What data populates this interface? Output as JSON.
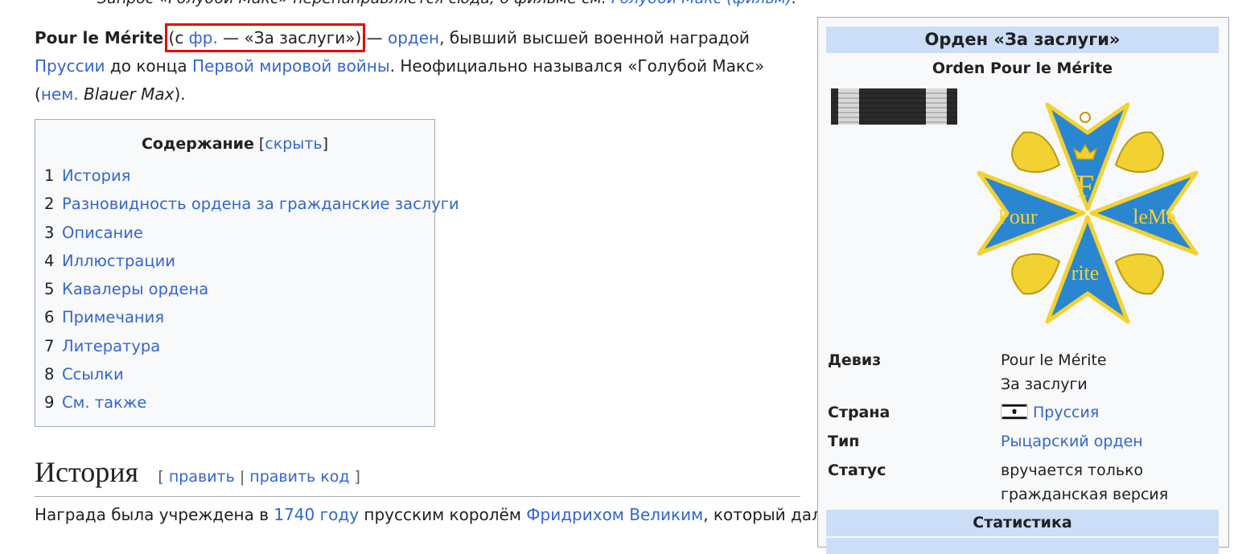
{
  "hatnote": {
    "text": "Запрос «Голубой Макс» перенаправляется сюда; о фильме см. ",
    "link": "Голубой Макс (фильм)",
    "end": "."
  },
  "lead": {
    "bold": "Pour le Mérite",
    "paren_open": "(с ",
    "fr_link": "фр.",
    "paren_rest": " — «За заслуги»)",
    "dash": " — ",
    "order_link": "орден",
    "t1": ", бывший высшей военной наградой ",
    "prussia_link": "Пруссии",
    "t2": " до конца ",
    "ww1_link": "Первой мировой войны",
    "t3": ". Неофициально назывался «Голубой Макс» (",
    "nem_link": "нем.",
    "italic": " Blauer Max",
    "t4": ")."
  },
  "toc": {
    "title": "Содержание",
    "hide_open": " [",
    "hide_link": "скрыть",
    "hide_close": "]",
    "items": [
      {
        "num": "1",
        "label": "История"
      },
      {
        "num": "2",
        "label": "Разновидность ордена за гражданские заслуги"
      },
      {
        "num": "3",
        "label": "Описание"
      },
      {
        "num": "4",
        "label": "Иллюстрации"
      },
      {
        "num": "5",
        "label": "Кавалеры ордена"
      },
      {
        "num": "6",
        "label": "Примечания"
      },
      {
        "num": "7",
        "label": "Литература"
      },
      {
        "num": "8",
        "label": "Ссылки"
      },
      {
        "num": "9",
        "label": "См. также"
      }
    ]
  },
  "section": {
    "title": "История",
    "edit_open": "[ ",
    "edit_link": "править",
    "edit_sep": " | ",
    "edit_code_link": "править код",
    "edit_close": " ]"
  },
  "body2": {
    "t1": "Награда была учреждена в ",
    "year_link": "1740 году",
    "t2": " прусским королём ",
    "king_link": "Фридрихом Великим",
    "t3": ", который дал"
  },
  "infobox": {
    "title": "Орден «За заслуги»",
    "subtitle": "Orden Pour le Mérite",
    "cross_text": {
      "f": "F",
      "pour": "Pour",
      "leme": "leMé",
      "rite": "rite"
    },
    "rows": {
      "motto_label": "Девиз",
      "motto_line1": "Pour le Mérite",
      "motto_line2": "За заслуги",
      "country_label": "Страна",
      "country_link": "Пруссия",
      "type_label": "Тип",
      "type_link": "Рыцарский орден",
      "status_label": "Статус",
      "status_line1": "вручается только",
      "status_line2": "гражданская версия"
    },
    "stats_header": "Статистика"
  },
  "colors": {
    "link": "#3366cc",
    "highlight_box": "#ee0000",
    "infobox_header": "#ccddf6",
    "cross_blue": "#2a86d0",
    "cross_gold": "#f2d233"
  }
}
